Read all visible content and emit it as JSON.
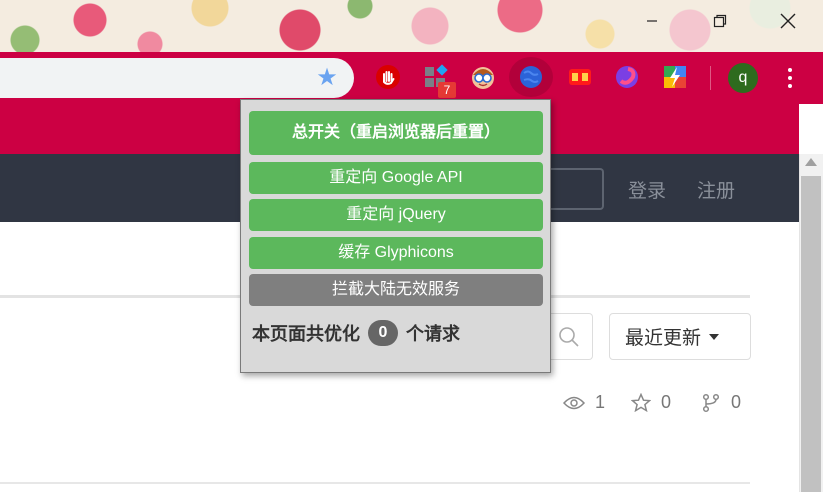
{
  "browser": {
    "window_controls": {
      "minimize_icon": "minimize-icon",
      "restore_icon": "restore-icon",
      "close_icon": "close-icon"
    },
    "toolbar": {
      "bookmark_icon": "star-icon",
      "extension_badge_count": "7",
      "profile_initial": "q",
      "menu_icon": "more-vert-icon",
      "theme_color": "#cc0043"
    }
  },
  "site": {
    "nav": {
      "login": "登录",
      "register": "注册"
    },
    "sort_button": "最近更新",
    "stats": {
      "watchers": "1",
      "stars": "0",
      "forks": "0"
    }
  },
  "popup": {
    "master_switch": "总开关（重启浏览器后重置）",
    "buttons": [
      "重定向 Google API",
      "重定向 jQuery",
      "缓存 Glyphicons",
      "拦截大陆无效服务"
    ],
    "summary_prefix": "本页面共优化",
    "summary_count": "0",
    "summary_suffix": "个请求",
    "colors": {
      "on": "#5cb85c",
      "off": "#7f7f7f",
      "background": "#d9d9d9"
    }
  }
}
